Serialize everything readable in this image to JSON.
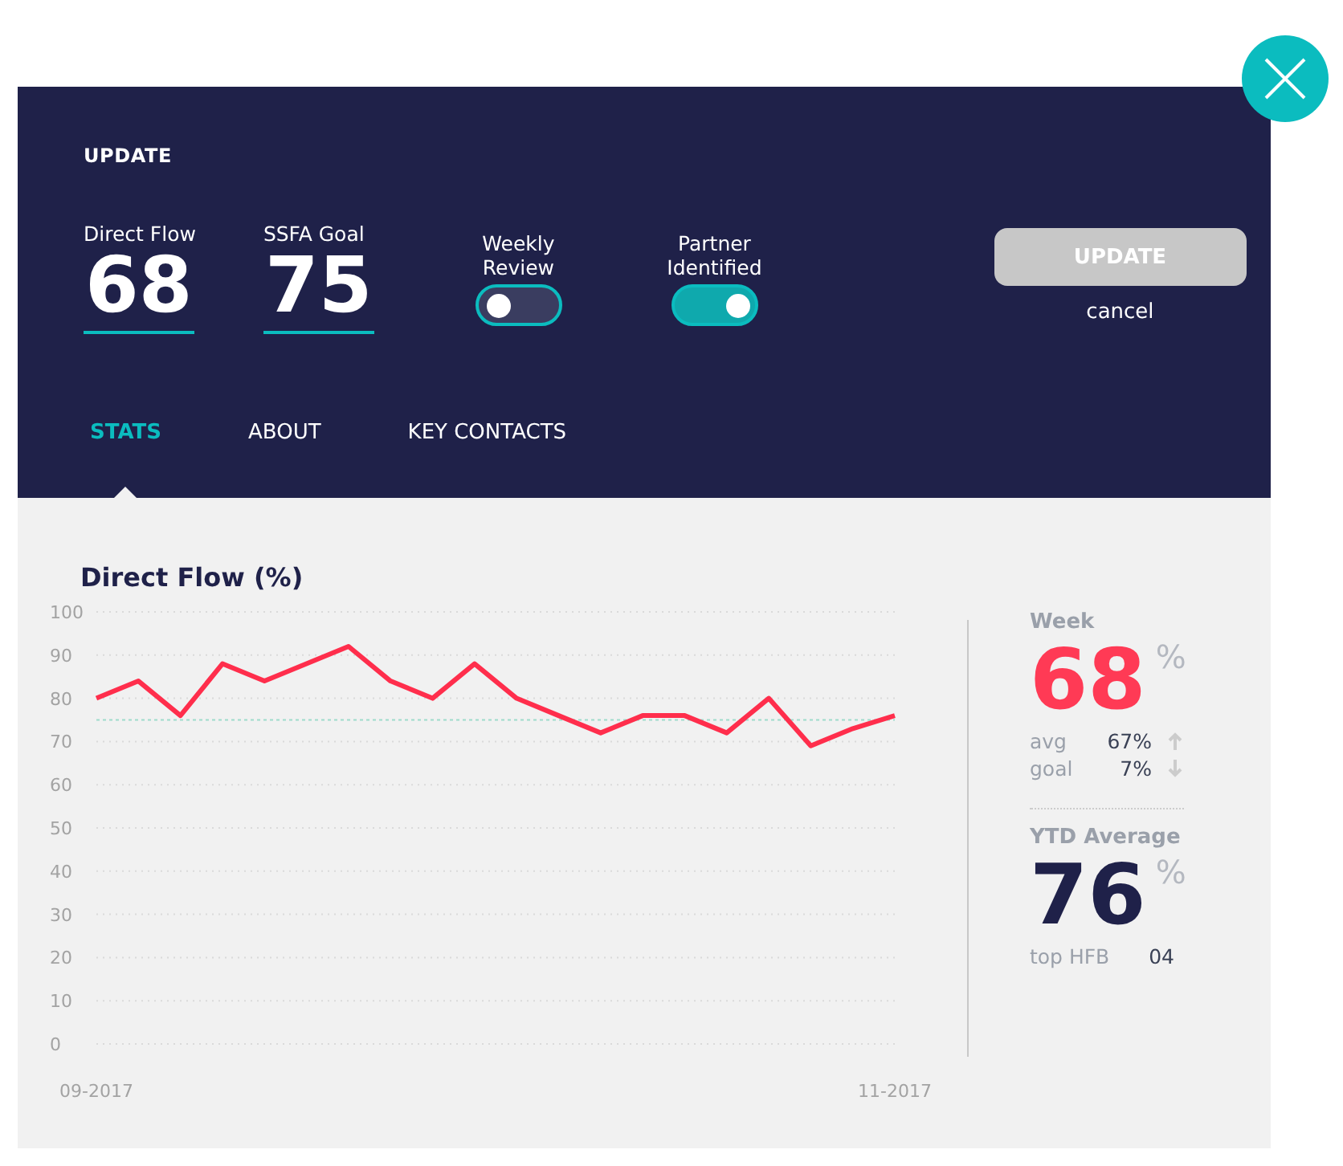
{
  "header": {
    "title": "UPDATE",
    "metrics": [
      {
        "label": "Direct Flow",
        "value": "68"
      },
      {
        "label": "SSFA Goal",
        "value": "75"
      }
    ],
    "toggles": [
      {
        "label": "Weekly Review",
        "on": false
      },
      {
        "label": "Partner Identified",
        "on": true
      }
    ],
    "update_button": {
      "label": "UPDATE",
      "disabled": true
    },
    "cancel_link": "cancel"
  },
  "tabs": [
    {
      "label": "STATS",
      "selected": true
    },
    {
      "label": "ABOUT",
      "selected": false
    },
    {
      "label": "KEY CONTACTS",
      "selected": false
    }
  ],
  "chart": {
    "title": "Direct Flow (%)",
    "chart_data": {
      "type": "line",
      "categories": [
        "09-2017",
        null,
        null,
        null,
        null,
        null,
        null,
        null,
        null,
        null,
        null,
        null,
        null,
        null,
        null,
        null,
        null,
        null,
        null,
        "11-2017"
      ],
      "series": [
        {
          "color": "#ff2e4c",
          "values": [
            80,
            84,
            76,
            88,
            84,
            88,
            92,
            84,
            80,
            88,
            80,
            76,
            72,
            76,
            76,
            72,
            80,
            69,
            73,
            76
          ]
        }
      ],
      "ylim": [
        0,
        100
      ],
      "yticks": [
        0,
        10,
        20,
        30,
        40,
        50,
        60,
        70,
        80,
        90,
        100
      ],
      "grid": true,
      "ref_lines": [
        {
          "axis": "y",
          "value": 75,
          "color": "#9edccc"
        }
      ]
    }
  },
  "week": {
    "label": "Week",
    "value": "68",
    "unit": "%",
    "rows": [
      {
        "label": "avg",
        "value": "67%",
        "kind": "up"
      },
      {
        "label": "goal",
        "value": "7%",
        "kind": "down"
      }
    ]
  },
  "ytd": {
    "label": "YTD Average",
    "value": "76",
    "unit": "%",
    "row": {
      "label": "top HFB",
      "value": "04"
    }
  }
}
